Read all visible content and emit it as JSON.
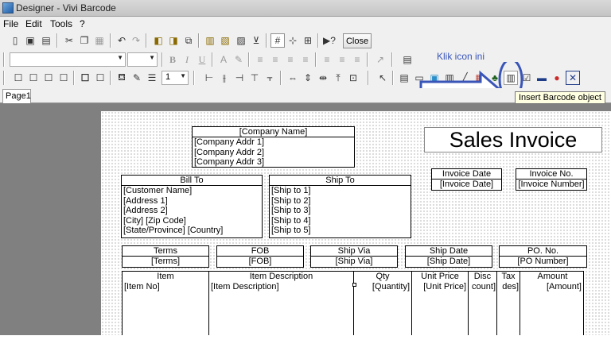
{
  "window": {
    "title": "Designer - Vivi Barcode"
  },
  "menu": [
    "File",
    "Edit",
    "Tools",
    "?"
  ],
  "toolbar": {
    "close_label": "Close",
    "line_width": "1"
  },
  "hint": "Klik icon ini",
  "tooltip": "Insert Barcode object",
  "tabs": [
    "Page1"
  ],
  "invoice": {
    "company": {
      "header": "[Company Name]",
      "lines": [
        "[Company Addr 1]",
        "[Company Addr 2]",
        "[Company Addr 3]"
      ]
    },
    "title": "Sales Invoice",
    "invoice_date": {
      "label": "Invoice Date",
      "value": "[Invoice Date]"
    },
    "invoice_no": {
      "label": "Invoice No.",
      "value": "[Invoice Number]"
    },
    "bill_to": {
      "header": "Bill To",
      "lines": [
        "[Customer Name]",
        "[Address 1]",
        "[Address 2]",
        "[City] [Zip Code]",
        "[State/Province] [Country]"
      ]
    },
    "ship_to": {
      "header": "Ship To",
      "lines": [
        "[Ship to 1]",
        "[Ship to 2]",
        "[Ship to 3]",
        "[Ship to 4]",
        "[Ship to 5]"
      ]
    },
    "terms": {
      "label": "Terms",
      "value": "[Terms]"
    },
    "fob": {
      "label": "FOB",
      "value": "[FOB]"
    },
    "ship_via": {
      "label": "Ship Via",
      "value": "[Ship Via]"
    },
    "ship_date": {
      "label": "Ship Date",
      "value": "[Ship Date]"
    },
    "po_no": {
      "label": "PO. No.",
      "value": "[PO Number]"
    },
    "columns": [
      {
        "label": "Item",
        "value": "[Item No]"
      },
      {
        "label": "Item Description",
        "value": "[Item Description]"
      },
      {
        "label": "Qty",
        "value": "[Quantity]"
      },
      {
        "label": "Unit Price",
        "value": "[Unit Price]"
      },
      {
        "label": "Disc",
        "value": "count]"
      },
      {
        "label": "Tax",
        "value": "des]"
      },
      {
        "label": "Amount",
        "value": "[Amount]"
      }
    ]
  },
  "colors": {
    "annotation": "#3a55b8",
    "tooltip_bg": "#ffffe1",
    "workspace": "#808080"
  }
}
